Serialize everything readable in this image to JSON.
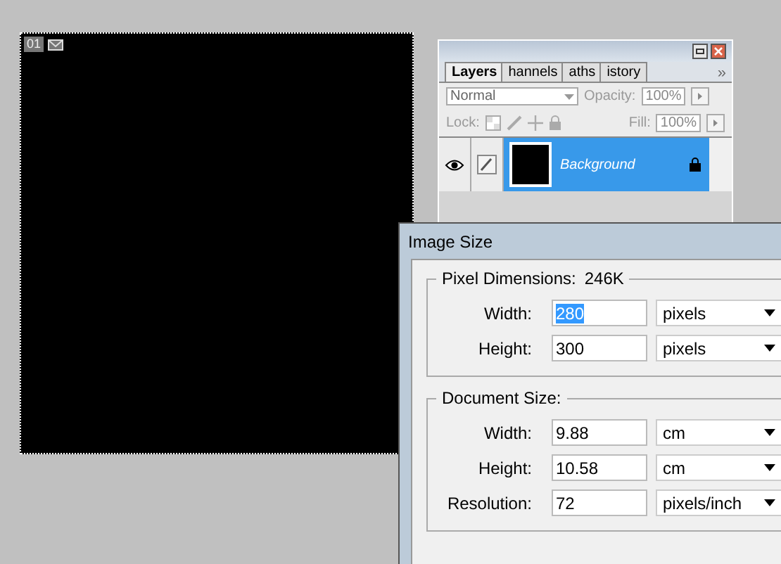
{
  "document": {
    "tag": "01"
  },
  "layers_panel": {
    "tabs": [
      {
        "label": "Layers",
        "selected": true
      },
      {
        "label": "hannels",
        "selected": false
      },
      {
        "label": "aths",
        "selected": false
      },
      {
        "label": "istory",
        "selected": false
      }
    ],
    "more": "»",
    "blend_mode": "Normal",
    "opacity_label": "Opacity:",
    "opacity": "100%",
    "lock_label": "Lock:",
    "fill_label": "Fill:",
    "fill": "100%",
    "layers": [
      {
        "name": "Background",
        "selected": true,
        "visible": true,
        "locked": true
      }
    ]
  },
  "dialog": {
    "title": "Image Size",
    "groups": [
      {
        "title": "Pixel Dimensions:",
        "extra": "246K",
        "fields": [
          {
            "label": "Width:",
            "value": "280",
            "highlighted": true,
            "unit": "pixels"
          },
          {
            "label": "Height:",
            "value": "300",
            "highlighted": false,
            "unit": "pixels"
          }
        ]
      },
      {
        "title": "Document Size:",
        "fields": [
          {
            "label": "Width:",
            "value": "9.88",
            "highlighted": false,
            "unit": "cm"
          },
          {
            "label": "Height:",
            "value": "10.58",
            "highlighted": false,
            "unit": "cm"
          },
          {
            "label": "Resolution:",
            "value": "72",
            "highlighted": false,
            "unit": "pixels/inch"
          }
        ]
      }
    ]
  }
}
